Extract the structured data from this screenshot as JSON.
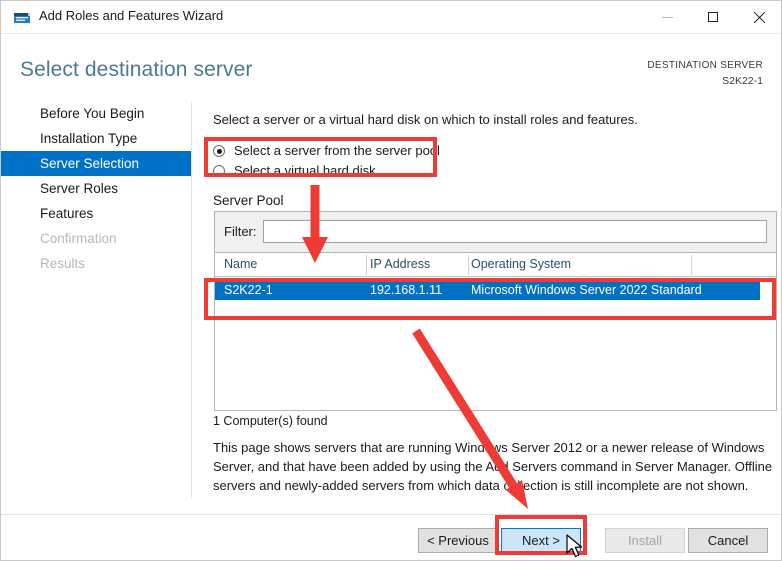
{
  "window": {
    "title": "Add Roles and Features Wizard",
    "icon": "wizard-icon",
    "minimize_label": "Minimize",
    "maximize_label": "Maximize",
    "close_label": "Close"
  },
  "header": {
    "page_title": "Select destination server",
    "destination_label": "DESTINATION SERVER",
    "destination_value": "S2K22-1",
    "title_color": "#4a7b92"
  },
  "sidebar": {
    "items": [
      {
        "label": "Before You Begin",
        "state": "normal"
      },
      {
        "label": "Installation Type",
        "state": "normal"
      },
      {
        "label": "Server Selection",
        "state": "selected"
      },
      {
        "label": "Server Roles",
        "state": "normal"
      },
      {
        "label": "Features",
        "state": "normal"
      },
      {
        "label": "Confirmation",
        "state": "disabled"
      },
      {
        "label": "Results",
        "state": "disabled"
      }
    ],
    "selected_color": "#0072c6"
  },
  "main": {
    "intro": "Select a server or a virtual hard disk on which to install roles and features.",
    "radios": [
      {
        "label": "Select a server from the server pool",
        "checked": true
      },
      {
        "label": "Select a virtual hard disk",
        "checked": false
      }
    ],
    "section_heading": "Server Pool",
    "filter": {
      "label": "Filter:",
      "value": "",
      "placeholder": ""
    },
    "grid": {
      "columns": [
        "Name",
        "IP Address",
        "Operating System"
      ],
      "rows": [
        {
          "name": "S2K22-1",
          "ip_address": "192.168.1.11",
          "operating_system": "Microsoft Windows Server 2022 Standard",
          "selected": true
        }
      ]
    },
    "found_text": "1 Computer(s) found",
    "help_text": "This page shows servers that are running Windows Server 2012 or a newer release of Windows Server, and that have been added by using the Add Servers command in Server Manager. Offline servers and newly-added servers from which data collection is still incomplete are not shown."
  },
  "footer": {
    "previous_label": "< Previous",
    "next_label": "Next >",
    "install_label": "Install",
    "cancel_label": "Cancel",
    "install_disabled": true,
    "next_focused": true
  },
  "annotations": {
    "color": "#ef3b36",
    "boxes": [
      "radio-select-server-from-pool",
      "server-pool-selected-row",
      "next-button"
    ],
    "arrows": [
      "down-arrow-to-server-pool",
      "diagonal-arrow-to-next-button"
    ]
  }
}
